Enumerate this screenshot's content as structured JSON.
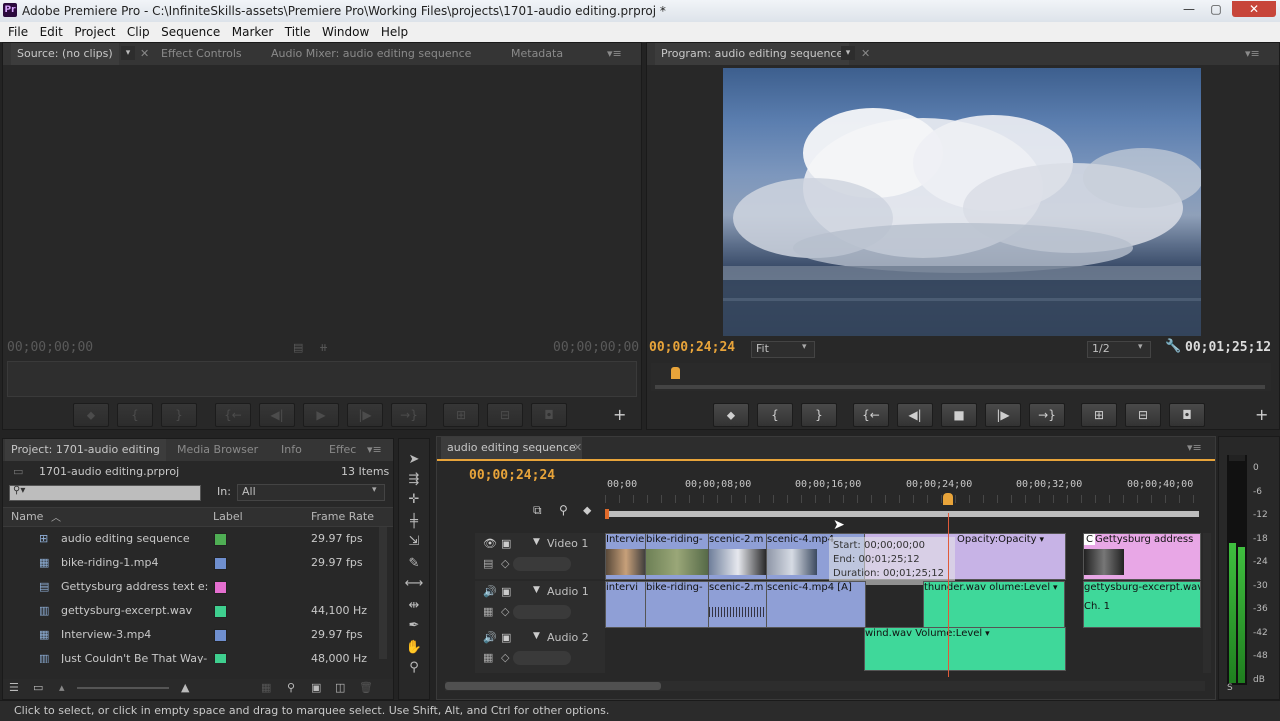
{
  "window": {
    "title": "Adobe Premiere Pro - C:\\InfiniteSkills-assets\\Premiere Pro\\Working Files\\projects\\1701-audio editing.prproj *",
    "logo": "Pr",
    "min": "—",
    "max": "▢",
    "close": "✕"
  },
  "menu": [
    "File",
    "Edit",
    "Project",
    "Clip",
    "Sequence",
    "Marker",
    "Title",
    "Window",
    "Help"
  ],
  "source_panel": {
    "tabs": [
      "Source: (no clips)",
      "Effect Controls",
      "Audio Mixer: audio editing sequence",
      "Metadata"
    ],
    "tc_left": "00;00;00;00",
    "tc_right": "00;00;00;00"
  },
  "program_panel": {
    "tab": "Program: audio editing sequence",
    "tc_current": "00;00;24;24",
    "fit": "Fit",
    "resolution": "1/2",
    "tc_duration": "00;01;25;12"
  },
  "project_panel": {
    "tabs": [
      "Project: 1701-audio editing",
      "Media Browser",
      "Info",
      "Effec"
    ],
    "project_file": "1701-audio editing.prproj",
    "item_count": "13 Items",
    "search_placeholder": "",
    "in_label": "In:",
    "in_value": "All",
    "columns": [
      "Name",
      "Label",
      "Frame Rate"
    ],
    "items": [
      {
        "name": "audio editing sequence",
        "color": "#4fae54",
        "rate": "29.97 fps",
        "icon": "sequence-icon"
      },
      {
        "name": "bike-riding-1.mp4",
        "color": "#6f8fcf",
        "rate": "29.97 fps",
        "icon": "video-icon"
      },
      {
        "name": "Gettysburg address text e:",
        "color": "#e46fcf",
        "rate": "",
        "icon": "title-icon"
      },
      {
        "name": "gettysburg-excerpt.wav",
        "color": "#3fcf8f",
        "rate": "44,100 Hz",
        "icon": "audio-icon"
      },
      {
        "name": "Interview-3.mp4",
        "color": "#6f8fcf",
        "rate": "29.97 fps",
        "icon": "video-icon"
      },
      {
        "name": "Just Couldn't Be That Way-",
        "color": "#3fcf8f",
        "rate": "48,000 Hz",
        "icon": "audio-icon"
      }
    ]
  },
  "timeline": {
    "tab": "audio editing sequence",
    "tc": "00;00;24;24",
    "ruler": [
      "00;00",
      "00;00;08;00",
      "00;00;16;00",
      "00;00;24;00",
      "00;00;32;00",
      "00;00;40;00"
    ],
    "tracks": [
      "Video 1",
      "Audio 1",
      "Audio 2"
    ],
    "video_clips": [
      "Intervie",
      "bike-riding-",
      "scenic-2.m",
      "scenic-4.mp4",
      "Opacity:Opacity",
      "C",
      "Gettysburg address"
    ],
    "audio1_clips": [
      "intervi",
      "bike-riding-",
      "scenic-2.m",
      "scenic-4.mp4 [A]",
      "thunder.wav",
      "olume:Level",
      "gettysburg-excerpt.wav",
      "Ch. 1"
    ],
    "audio2_clips": [
      "wind.wav",
      "Volume:Level"
    ],
    "tooltip": {
      "start": "Start: 00;00;00;00",
      "end": "End: 00;01;25;12",
      "duration": "Duration: 00;01;25;12"
    }
  },
  "meter": {
    "labels": [
      "0",
      "-6",
      "-12",
      "-18",
      "-24",
      "-30",
      "-36",
      "-42",
      "-48",
      "dB"
    ],
    "solo": "S"
  },
  "status": "Click to select, or click in empty space and drag to marquee select. Use Shift, Alt, and Ctrl for other options."
}
